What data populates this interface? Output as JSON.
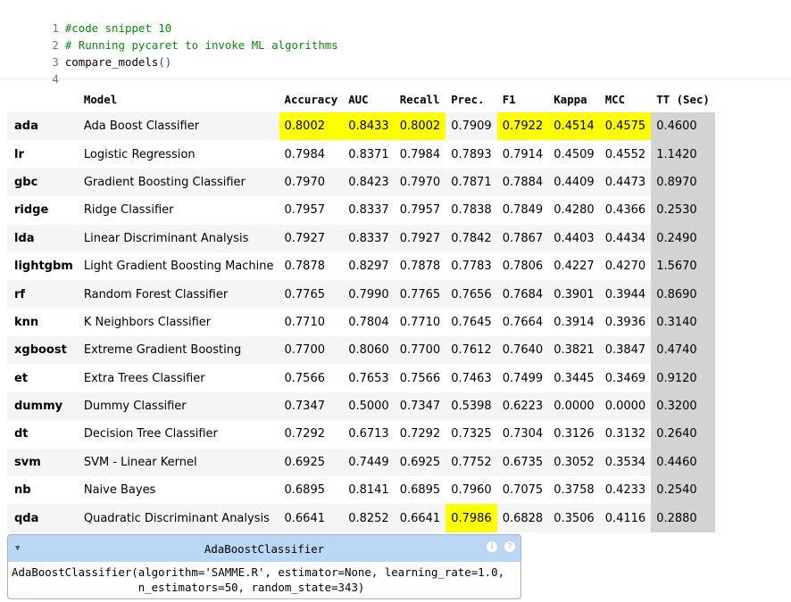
{
  "code_cell": {
    "lines": [
      {
        "num": "1",
        "text": "#code snippet 10"
      },
      {
        "num": "2",
        "text": "# Running pycaret to invoke ML algorithms"
      },
      {
        "num": "3",
        "code": "compare_models",
        "paren": "()"
      },
      {
        "num": "4",
        "text": ""
      }
    ]
  },
  "table": {
    "headers": [
      "",
      "Model",
      "Accuracy",
      "AUC",
      "Recall",
      "Prec.",
      "F1",
      "Kappa",
      "MCC",
      "TT (Sec)"
    ],
    "rows": [
      {
        "idx": "ada",
        "model": "Ada Boost Classifier",
        "vals": [
          "0.8002",
          "0.8433",
          "0.8002",
          "0.7909",
          "0.7922",
          "0.4514",
          "0.4575"
        ],
        "tt": "0.4600"
      },
      {
        "idx": "lr",
        "model": "Logistic Regression",
        "vals": [
          "0.7984",
          "0.8371",
          "0.7984",
          "0.7893",
          "0.7914",
          "0.4509",
          "0.4552"
        ],
        "tt": "1.1420"
      },
      {
        "idx": "gbc",
        "model": "Gradient Boosting Classifier",
        "vals": [
          "0.7970",
          "0.8423",
          "0.7970",
          "0.7871",
          "0.7884",
          "0.4409",
          "0.4473"
        ],
        "tt": "0.8970"
      },
      {
        "idx": "ridge",
        "model": "Ridge Classifier",
        "vals": [
          "0.7957",
          "0.8337",
          "0.7957",
          "0.7838",
          "0.7849",
          "0.4280",
          "0.4366"
        ],
        "tt": "0.2530"
      },
      {
        "idx": "lda",
        "model": "Linear Discriminant Analysis",
        "vals": [
          "0.7927",
          "0.8337",
          "0.7927",
          "0.7842",
          "0.7867",
          "0.4403",
          "0.4434"
        ],
        "tt": "0.2490"
      },
      {
        "idx": "lightgbm",
        "model": "Light Gradient Boosting Machine",
        "vals": [
          "0.7878",
          "0.8297",
          "0.7878",
          "0.7783",
          "0.7806",
          "0.4227",
          "0.4270"
        ],
        "tt": "1.5670"
      },
      {
        "idx": "rf",
        "model": "Random Forest Classifier",
        "vals": [
          "0.7765",
          "0.7990",
          "0.7765",
          "0.7656",
          "0.7684",
          "0.3901",
          "0.3944"
        ],
        "tt": "0.8690"
      },
      {
        "idx": "knn",
        "model": "K Neighbors Classifier",
        "vals": [
          "0.7710",
          "0.7804",
          "0.7710",
          "0.7645",
          "0.7664",
          "0.3914",
          "0.3936"
        ],
        "tt": "0.3140"
      },
      {
        "idx": "xgboost",
        "model": "Extreme Gradient Boosting",
        "vals": [
          "0.7700",
          "0.8060",
          "0.7700",
          "0.7612",
          "0.7640",
          "0.3821",
          "0.3847"
        ],
        "tt": "0.4740"
      },
      {
        "idx": "et",
        "model": "Extra Trees Classifier",
        "vals": [
          "0.7566",
          "0.7653",
          "0.7566",
          "0.7463",
          "0.7499",
          "0.3445",
          "0.3469"
        ],
        "tt": "0.9120"
      },
      {
        "idx": "dummy",
        "model": "Dummy Classifier",
        "vals": [
          "0.7347",
          "0.5000",
          "0.7347",
          "0.5398",
          "0.6223",
          "0.0000",
          "0.0000"
        ],
        "tt": "0.3200"
      },
      {
        "idx": "dt",
        "model": "Decision Tree Classifier",
        "vals": [
          "0.7292",
          "0.6713",
          "0.7292",
          "0.7325",
          "0.7304",
          "0.3126",
          "0.3132"
        ],
        "tt": "0.2640"
      },
      {
        "idx": "svm",
        "model": "SVM - Linear Kernel",
        "vals": [
          "0.6925",
          "0.7449",
          "0.6925",
          "0.7752",
          "0.6735",
          "0.3052",
          "0.3534"
        ],
        "tt": "0.4460"
      },
      {
        "idx": "nb",
        "model": "Naive Bayes",
        "vals": [
          "0.6895",
          "0.8141",
          "0.6895",
          "0.7960",
          "0.7075",
          "0.3758",
          "0.4233"
        ],
        "tt": "0.2540"
      },
      {
        "idx": "qda",
        "model": "Quadratic Discriminant Analysis",
        "vals": [
          "0.6641",
          "0.8252",
          "0.6641",
          "0.7986",
          "0.6828",
          "0.3506",
          "0.4116"
        ],
        "tt": "0.2880"
      }
    ],
    "highlighted": [
      [
        0,
        0
      ],
      [
        0,
        1
      ],
      [
        0,
        2
      ],
      [
        0,
        4
      ],
      [
        0,
        5
      ],
      [
        0,
        6
      ],
      [
        14,
        3
      ]
    ],
    "colors": {
      "highlight": "#ffff00",
      "tt_column": "#d3d3d3",
      "stripe": "#f5f5f5"
    }
  },
  "estimator": {
    "toggle_icon": "triangle-down-icon",
    "title": "AdaBoostClassifier",
    "icons": [
      "info-icon",
      "help-icon"
    ],
    "icon_glyphs": [
      "i",
      "?"
    ],
    "line1": "AdaBoostClassifier(algorithm='SAMME.R', estimator=None, learning_rate=1.0,",
    "line2": "                   n_estimators=50, random_state=343)",
    "header_color": "#bcd6f5"
  }
}
